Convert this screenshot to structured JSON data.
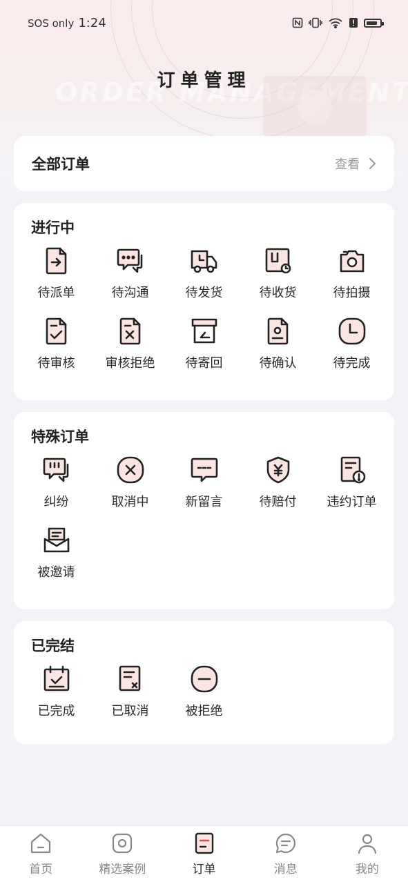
{
  "status_bar": {
    "carrier": "SOS only",
    "time": "1:24"
  },
  "page": {
    "title": "订单管理",
    "watermark": "ORDER MANAGEMENT"
  },
  "all_orders": {
    "title": "全部订单",
    "view_label": "查看"
  },
  "sections": {
    "in_progress": {
      "title": "进行中",
      "items": [
        {
          "label": "待派单",
          "icon": "dispatch-icon"
        },
        {
          "label": "待沟通",
          "icon": "chat-icon"
        },
        {
          "label": "待发货",
          "icon": "truck-icon"
        },
        {
          "label": "待收货",
          "icon": "package-icon"
        },
        {
          "label": "待拍摄",
          "icon": "camera-icon"
        },
        {
          "label": "待审核",
          "icon": "document-check-icon"
        },
        {
          "label": "审核拒绝",
          "icon": "document-x-icon"
        },
        {
          "label": "待寄回",
          "icon": "return-box-icon"
        },
        {
          "label": "待确认",
          "icon": "document-person-icon"
        },
        {
          "label": "待完成",
          "icon": "clock-icon"
        }
      ]
    },
    "special": {
      "title": "特殊订单",
      "items": [
        {
          "label": "纠纷",
          "icon": "dispute-icon"
        },
        {
          "label": "取消中",
          "icon": "cancel-circle-icon"
        },
        {
          "label": "新留言",
          "icon": "message-icon"
        },
        {
          "label": "待赔付",
          "icon": "shield-yen-icon"
        },
        {
          "label": "违约订单",
          "icon": "document-warning-icon"
        },
        {
          "label": "被邀请",
          "icon": "envelope-icon"
        }
      ]
    },
    "finished": {
      "title": "已完结",
      "items": [
        {
          "label": "已完成",
          "icon": "calendar-check-icon"
        },
        {
          "label": "已取消",
          "icon": "document-cancelled-icon"
        },
        {
          "label": "被拒绝",
          "icon": "minus-circle-icon"
        }
      ]
    }
  },
  "tabbar": {
    "items": [
      {
        "label": "首页",
        "icon": "home-icon"
      },
      {
        "label": "精选案例",
        "icon": "featured-icon"
      },
      {
        "label": "订单",
        "icon": "order-icon",
        "active": true
      },
      {
        "label": "消息",
        "icon": "message-bubble-icon"
      },
      {
        "label": "我的",
        "icon": "user-icon"
      }
    ]
  },
  "colors": {
    "accent_fill": "#fbe5e2",
    "stroke": "#222222",
    "inactive_tab": "#888888"
  }
}
